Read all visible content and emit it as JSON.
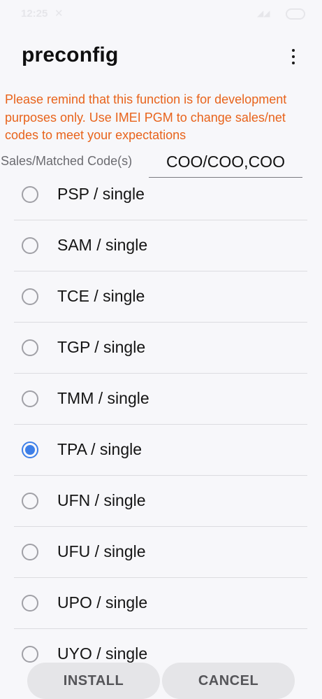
{
  "status_bar": {
    "time": "12:25",
    "x_glyph": "✕",
    "signal_glyph": "◢◢"
  },
  "app_bar": {
    "title": "preconfig",
    "more_icon": "more-vertical-icon"
  },
  "warning": {
    "text": "Please remind that this function is for development purposes only. Use IMEI PGM to change sales/net codes to meet your expectations",
    "color": "#e8631b"
  },
  "sales_codes": {
    "label": "Sales/Matched Code(s)",
    "value": "COO/COO,COO"
  },
  "options": [
    {
      "label": "PSP / single",
      "checked": false
    },
    {
      "label": "SAM / single",
      "checked": false
    },
    {
      "label": "TCE / single",
      "checked": false
    },
    {
      "label": "TGP / single",
      "checked": false
    },
    {
      "label": "TMM / single",
      "checked": false
    },
    {
      "label": "TPA / single",
      "checked": true
    },
    {
      "label": "UFN / single",
      "checked": false
    },
    {
      "label": "UFU / single",
      "checked": false
    },
    {
      "label": "UPO / single",
      "checked": false
    },
    {
      "label": "UYO / single",
      "checked": false
    }
  ],
  "buttons": {
    "install": "INSTALL",
    "cancel": "CANCEL"
  },
  "colors": {
    "accent": "#3d7fe8",
    "background": "#f7f7fa",
    "button_bg": "#e5e5e8"
  }
}
